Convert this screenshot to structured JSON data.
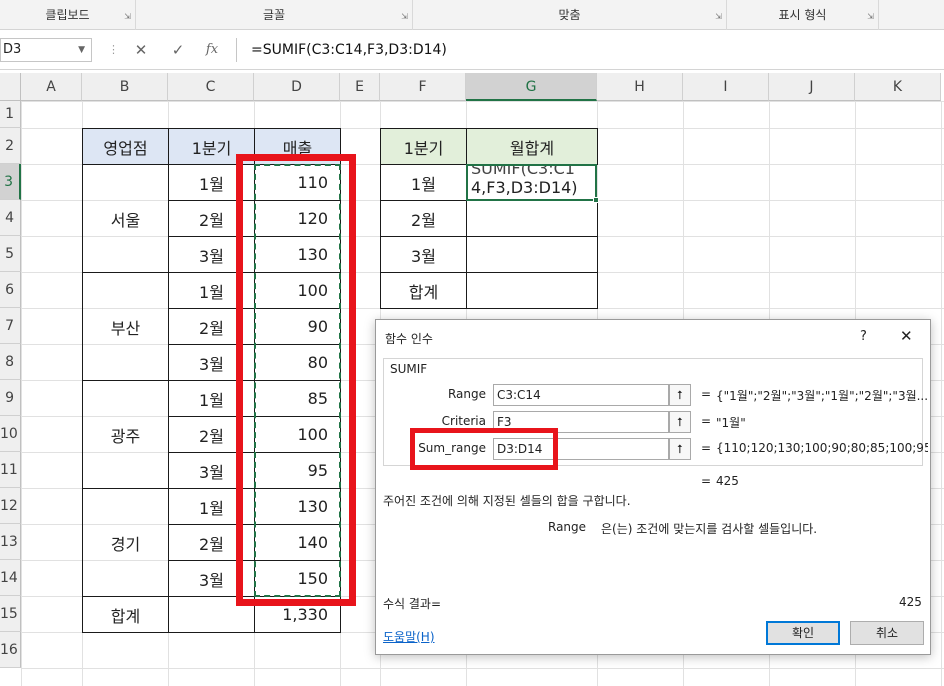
{
  "ribbon": {
    "groups": [
      "클립보드",
      "글꼴",
      "맞춤",
      "표시 형식"
    ]
  },
  "formula_bar": {
    "name_box": "D3",
    "formula": "=SUMIF(C3:C14,F3,D3:D14)",
    "fx_label": "fx"
  },
  "columns": [
    "A",
    "B",
    "C",
    "D",
    "E",
    "F",
    "G",
    "H",
    "I",
    "J",
    "K"
  ],
  "rows": [
    "1",
    "2",
    "3",
    "4",
    "5",
    "6",
    "7",
    "8",
    "9",
    "10",
    "11",
    "12",
    "13",
    "14",
    "15",
    "16"
  ],
  "table1": {
    "headers": [
      "영업점",
      "1분기",
      "매출"
    ],
    "branches": [
      "서울",
      "부산",
      "광주",
      "경기"
    ],
    "months": [
      "1월",
      "2월",
      "3월",
      "1월",
      "2월",
      "3월",
      "1월",
      "2월",
      "3월",
      "1월",
      "2월",
      "3월"
    ],
    "sales": [
      "110",
      "120",
      "130",
      "100",
      "90",
      "80",
      "85",
      "100",
      "95",
      "130",
      "140",
      "150"
    ],
    "total_label": "합계",
    "total_value": "1,330"
  },
  "table2": {
    "headers": [
      "1분기",
      "월합계"
    ],
    "labels": [
      "1월",
      "2월",
      "3월",
      "합계"
    ],
    "g3_line1": "SUMIF(C3:C1",
    "g3_line2": "4,F3,D3:D14)"
  },
  "dialog": {
    "title": "함수 인수",
    "help_q": "?",
    "close": "✕",
    "func_name": "SUMIF",
    "args": [
      {
        "label": "Range",
        "value": "C3:C14",
        "result": "{\"1월\";\"2월\";\"3월\";\"1월\";\"2월\";\"3월..."
      },
      {
        "label": "Criteria",
        "value": "F3",
        "result": "\"1월\""
      },
      {
        "label": "Sum_range",
        "value": "D3:D14",
        "result": "{110;120;130;100;90;80;85;100;95..."
      }
    ],
    "eq": "=",
    "result_preview": "425",
    "description": "주어진 조건에 의해 지정된 셀들의 합을 구합니다.",
    "arg_help_name": "Range",
    "arg_help_text": "은(는) 조건에 맞는지를 검사할 셀들입니다.",
    "formula_result_label": "수식 결과=",
    "formula_result_value": "425",
    "help_link": "도움말(H)",
    "ok": "확인",
    "cancel": "취소"
  },
  "colors": {
    "accent": "#217346",
    "highlight_red": "#e8141b",
    "header_blue": "#dde6f4",
    "header_green": "#e2efda"
  }
}
